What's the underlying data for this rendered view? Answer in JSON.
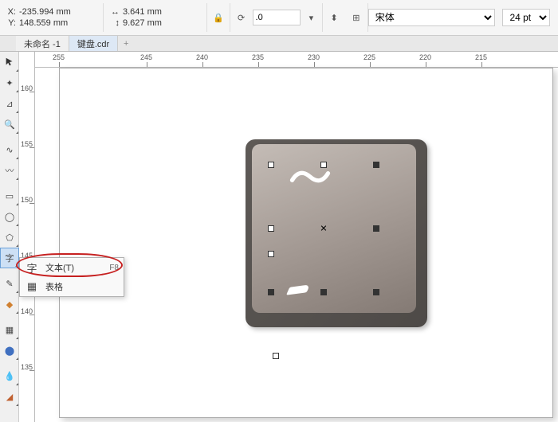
{
  "coords": {
    "x_label": "X:",
    "x": "-235.994 mm",
    "y_label": "Y:",
    "y": "148.559 mm"
  },
  "dims": {
    "w_label": "↔",
    "w": "3.641 mm",
    "h_label": "↕",
    "h": "9.627 mm"
  },
  "rotation": {
    "value": ".0"
  },
  "font": {
    "name": "宋体",
    "size": "24 pt"
  },
  "tabs": {
    "t1": "未命名 -1",
    "t2": "键盘.cdr"
  },
  "ruler_h": {
    "t0": "255",
    "t1": "245",
    "t2": "240",
    "t3": "235",
    "t4": "230",
    "t5": "225",
    "t6": "220",
    "t7": "215"
  },
  "ruler_v": {
    "t0": "160",
    "t1": "155",
    "t2": "150",
    "t3": "145",
    "t4": "140",
    "t5": "135"
  },
  "flyout": {
    "text_icon": "字",
    "text_label": "文本(T)",
    "text_shortcut": "F8",
    "table_label": "表格"
  },
  "icons": {
    "pick": "▲",
    "shape": "✶",
    "crop": "✂",
    "zoom": "🔍",
    "freehand": "∿",
    "bezier": "〰",
    "rect": "▭",
    "ellipse": "◯",
    "poly": "⬠",
    "text": "字",
    "dropper": "✎",
    "fill": "▤",
    "interactive": "⚞",
    "outline": "◧",
    "eyedrop": "💧",
    "paint": "🪣"
  }
}
